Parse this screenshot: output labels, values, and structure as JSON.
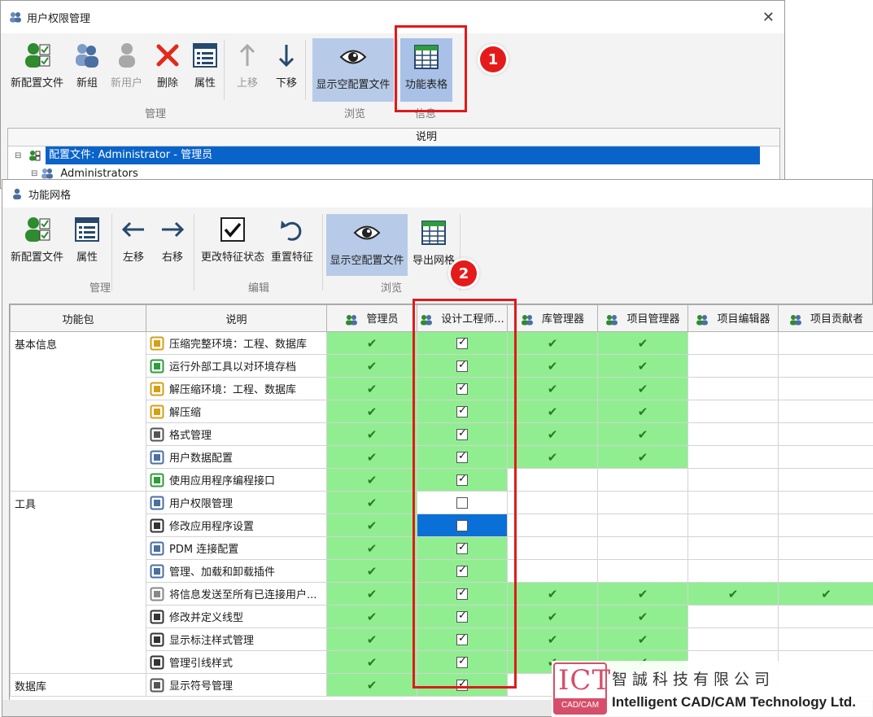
{
  "back_window": {
    "title": "用户权限管理",
    "ribbon": {
      "new_profile": "新配置文件",
      "new_group": "新组",
      "new_user": "新用户",
      "delete": "删除",
      "properties": "属性",
      "move_up": "上移",
      "move_down": "下移",
      "show_empty": "显示空配置文件",
      "feature_table": "功能表格",
      "group_manage": "管理",
      "group_browse": "浏览",
      "group_info": "信息"
    },
    "tree": {
      "header": "说明",
      "rows": [
        "配置文件: Administrator - 管理员",
        "Administrators"
      ]
    }
  },
  "front_window": {
    "title": "功能网格",
    "ribbon": {
      "new_profile": "新配置文件",
      "properties": "属性",
      "move_left": "左移",
      "move_right": "右移",
      "change_state": "更改特征状态",
      "reset_feature": "重置特征",
      "show_empty": "显示空配置文件",
      "export_grid": "导出网格",
      "group_manage": "管理",
      "group_edit": "编辑",
      "group_browse": "浏览"
    },
    "grid": {
      "headers": [
        "功能包",
        "说明",
        "管理员",
        "设计工程师...",
        "库管理器",
        "项目管理器",
        "项目编辑器",
        "项目贡献者"
      ],
      "categories": [
        "基本信息",
        "工具",
        "数据库"
      ],
      "rows": [
        {
          "desc": "压缩完整环境：工程、数据库"
        },
        {
          "desc": "运行外部工具以对环境存档"
        },
        {
          "desc": "解压缩环境：工程、数据库"
        },
        {
          "desc": "解压缩"
        },
        {
          "desc": "格式管理"
        },
        {
          "desc": "用户数据配置"
        },
        {
          "desc": "使用应用程序编程接口"
        },
        {
          "desc": "用户权限管理"
        },
        {
          "desc": "修改应用程序设置"
        },
        {
          "desc": "PDM 连接配置"
        },
        {
          "desc": "管理、加载和卸载插件"
        },
        {
          "desc": "将信息发送至所有已连接用户..."
        },
        {
          "desc": "修改并定义线型"
        },
        {
          "desc": "显示标注样式管理"
        },
        {
          "desc": "管理引线样式"
        },
        {
          "desc": "显示符号管理"
        }
      ]
    }
  },
  "annotations": {
    "badge1": "1",
    "badge2": "2"
  },
  "logo": {
    "mark": "ICT",
    "mark_sub": "CAD/CAM",
    "cn": "智誠科技有限公司",
    "en": "Intelligent CAD/CAM Technology Ltd."
  },
  "colors": {
    "granted": "#90ee90",
    "selection": "#0a63c9",
    "annotation": "#e01a1a",
    "logo": "#d64f6a"
  }
}
